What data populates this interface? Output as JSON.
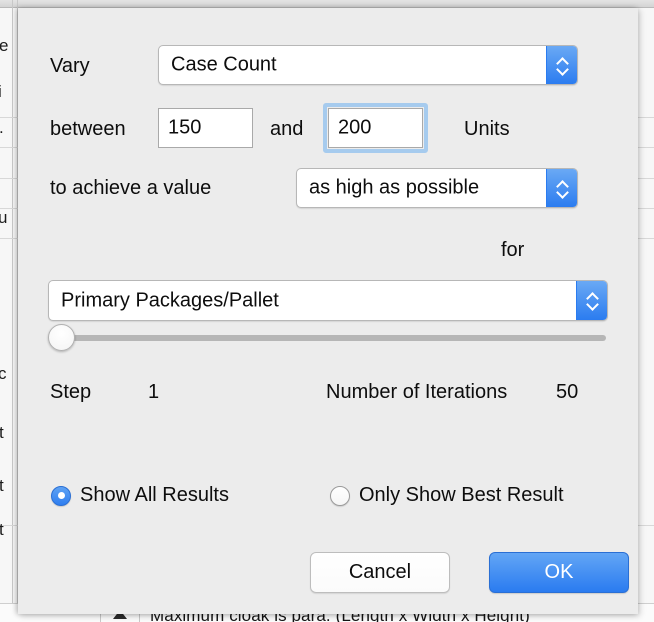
{
  "background": {
    "bottom_row_text": "Maximum cloak is para. (Length x Width x Height)",
    "left_fragments": [
      "e",
      "i",
      ".",
      "u",
      "c",
      "t",
      "t",
      "t"
    ],
    "caret_icon": "triangle-down-icon"
  },
  "dialog": {
    "vary_label": "Vary",
    "vary_select": {
      "value": "Case Count",
      "options": [
        "Case Count"
      ],
      "stepper_icon": "chevron-up-down-icon"
    },
    "between_label": "between",
    "min_value": "150",
    "and_label": "and",
    "max_value": "200",
    "units_label": "Units",
    "achieve_label": "to achieve a value",
    "goal_select": {
      "value": "as high as possible",
      "options": [
        "as high as possible"
      ],
      "stepper_icon": "chevron-up-down-icon"
    },
    "for_label": "for",
    "target_select": {
      "value": "Primary Packages/Pallet",
      "options": [
        "Primary Packages/Pallet"
      ],
      "stepper_icon": "chevron-up-down-icon"
    },
    "slider": {
      "value": 0,
      "min": 0,
      "max": 100
    },
    "step_label": "Step",
    "step_value": "1",
    "iterations_label": "Number of Iterations",
    "iterations_value": "50",
    "radios": [
      {
        "label": "Show All Results",
        "selected": true
      },
      {
        "label": "Only Show Best Result",
        "selected": false
      }
    ],
    "cancel_label": "Cancel",
    "ok_label": "OK"
  },
  "colors": {
    "dialog_bg": "#ececec",
    "accent_blue": "#2b7cf0",
    "focus_ring": "#a6cbee",
    "track_gray": "#b6b6b6"
  }
}
